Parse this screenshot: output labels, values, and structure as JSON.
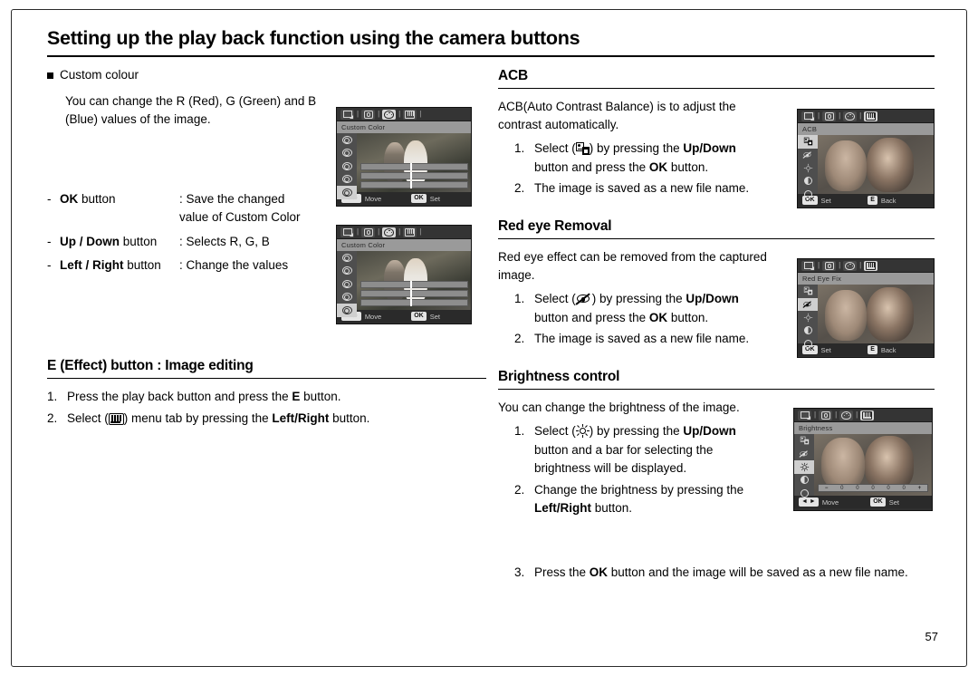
{
  "page": {
    "title": "Setting up the play back function using the camera buttons",
    "number": "57"
  },
  "left_column": {
    "custom_colour": {
      "heading": "Custom colour",
      "paragraph": "You can change the R (Red), G (Green) and B (Blue) values of the image.",
      "definitions": [
        {
          "dash": "-",
          "term_bold": "OK",
          "term_rest": " button",
          "desc": ": Save the changed",
          "desc_cont": "value of Custom Color"
        },
        {
          "dash": "-",
          "term_bold": "Up / Down",
          "term_rest": " button",
          "desc": ": Selects R, G, B",
          "desc_cont": ""
        },
        {
          "dash": "-",
          "term_bold": "Left / Right",
          "term_rest": " button",
          "desc": ": Change the values",
          "desc_cont": ""
        }
      ]
    },
    "effect_section": {
      "heading": "E (Effect) button : Image editing",
      "steps": [
        {
          "num": "1.",
          "pre": "Press the play back button and press the ",
          "bold": "E",
          "post": " button.",
          "icon": ""
        },
        {
          "num": "2.",
          "pre": "Select (",
          "icon": "menu-tab-icon",
          "mid": ") menu tab by pressing the ",
          "bold": "Left/Right",
          "post": " button."
        }
      ]
    }
  },
  "right_column": {
    "acb": {
      "heading": "ACB",
      "paragraph": "ACB(Auto Contrast Balance) is to adjust the contrast automatically.",
      "steps": [
        {
          "num": "1.",
          "pre": "Select (",
          "icon": "acb-icon",
          "mid": ") by pressing the ",
          "bold": "Up/Down",
          "post": "",
          "line2_pre": "button and press the ",
          "line2_bold": "OK",
          "line2_post": " button."
        },
        {
          "num": "2.",
          "pre": "The image is saved as a new file name.",
          "icon": "",
          "mid": "",
          "bold": "",
          "post": ""
        }
      ]
    },
    "red_eye": {
      "heading": "Red eye Removal",
      "paragraph": "Red eye effect can be removed from the captured image.",
      "steps": [
        {
          "num": "1.",
          "pre": "Select (",
          "icon": "red-eye-icon",
          "mid": ") by pressing the ",
          "bold": "Up/Down",
          "post": "",
          "line2_pre": "button and press the ",
          "line2_bold": "OK",
          "line2_post": " button."
        },
        {
          "num": "2.",
          "pre": "The image is saved as a new file name.",
          "icon": "",
          "mid": "",
          "bold": "",
          "post": ""
        }
      ]
    },
    "brightness": {
      "heading": "Brightness control",
      "paragraph": "You can change the brightness of the image.",
      "steps": [
        {
          "num": "1.",
          "pre": "Select (",
          "icon": "brightness-icon",
          "mid": ") by pressing the ",
          "bold": "Up/Down",
          "post": "",
          "line2_pre": "button and a bar for selecting the",
          "line3": "brightness will be displayed."
        },
        {
          "num": "2.",
          "pre": "Change the brightness by pressing the",
          "line2_bold": "Left/Right",
          "line2_post": "  button."
        },
        {
          "num": "3.",
          "pre": "Press the ",
          "bold": "OK",
          "post": " button and the image will be saved as a new file name."
        }
      ]
    }
  },
  "lcd_screens": {
    "custom_color_1": {
      "title": "Custom Color",
      "selected_tab": 2,
      "selected_side": 5,
      "bottom": {
        "nav": "◄ ►",
        "nav_label": "Move",
        "ok": "OK",
        "ok_label": "Set"
      }
    },
    "custom_color_2": {
      "title": "Custom Color",
      "selected_tab": 2,
      "selected_side": 5,
      "bottom": {
        "nav": "◄ ►",
        "nav_label": "Move",
        "ok": "OK",
        "ok_label": "Set"
      }
    },
    "acb": {
      "title": "ACB",
      "selected_tab": 3,
      "selected_side": 0,
      "bottom": {
        "ok": "OK",
        "ok_label": "Set",
        "back": "E",
        "back_label": "Back"
      }
    },
    "red_eye": {
      "title": "Red Eye Fix",
      "selected_tab": 3,
      "selected_side": 1,
      "bottom": {
        "ok": "OK",
        "ok_label": "Set",
        "back": "E",
        "back_label": "Back"
      }
    },
    "brightness": {
      "title": "Brightness",
      "selected_tab": 3,
      "selected_side": 2,
      "bottom": {
        "nav": "◄ ►",
        "nav_label": "Move",
        "ok": "OK",
        "ok_label": "Set"
      },
      "bar_values": [
        "−",
        "0",
        "0",
        "0",
        "0",
        "0",
        "+"
      ]
    }
  },
  "colors": {
    "ink": "#000000",
    "lcd_bg": "#2f2f2f",
    "lcd_title_bar": "#9a9a9a",
    "lcd_selected": "#d8d8d8"
  }
}
